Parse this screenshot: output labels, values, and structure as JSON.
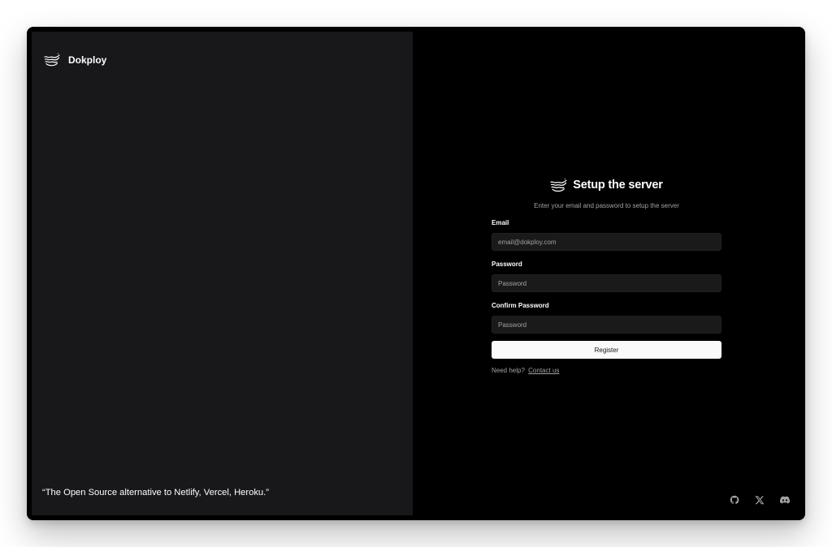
{
  "brand": {
    "name": "Dokploy",
    "logo_icon": "dokploy-logo-icon"
  },
  "left": {
    "quote": "“The Open Source alternative to Netlify, Vercel, Heroku.”"
  },
  "form": {
    "title": "Setup the server",
    "subtitle": "Enter your email and password to setup the server",
    "email_label": "Email",
    "email_placeholder": "email@dokploy.com",
    "password_label": "Password",
    "password_placeholder": "Password",
    "confirm_label": "Confirm Password",
    "confirm_placeholder": "Password",
    "register_label": "Register",
    "help_text": "Need help?",
    "help_link": "Contact us"
  },
  "social": {
    "icons": [
      "github-icon",
      "x-icon",
      "discord-icon"
    ]
  },
  "colors": {
    "background": "#000000",
    "panel": "#18181b",
    "input": "#1a1a1a",
    "button": "#fafafa",
    "muted_text": "#a1a1aa"
  }
}
